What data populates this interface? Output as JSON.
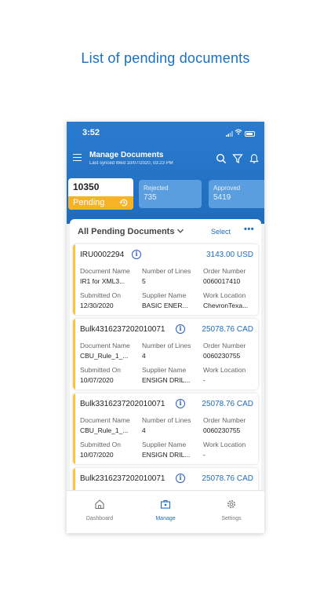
{
  "caption": "List of pending documents",
  "status_bar": {
    "time": "3:52"
  },
  "header": {
    "title": "Manage Documents",
    "subtitle": "Last synced Wed 10/07/2020, 03:23 PM"
  },
  "tiles": {
    "pending": {
      "count": "10350",
      "label": "Pending"
    },
    "rejected": {
      "label": "Rejected",
      "value": "735"
    },
    "approved": {
      "label": "Approved",
      "value": "5419"
    }
  },
  "list": {
    "title": "All Pending Documents",
    "select_label": "Select",
    "more_label": "•••",
    "labels": {
      "document_name": "Document Name",
      "number_of_lines": "Number of Lines",
      "order_number": "Order Number",
      "submitted_on": "Submitted On",
      "supplier_name": "Supplier Name",
      "work_location": "Work Location"
    },
    "cards": [
      {
        "id": "IRU0002294",
        "amount": "3143.00 USD",
        "document_name": "IR1 for XML3...",
        "number_of_lines": "5",
        "order_number": "0060017410",
        "submitted_on": "12/30/2020",
        "supplier_name": "BASIC ENER...",
        "work_location": "ChevronTexa..."
      },
      {
        "id": "Bulk4316237202010071",
        "amount": "25078.76 CAD",
        "document_name": "CBU_Rule_1_...",
        "number_of_lines": "4",
        "order_number": "0060230755",
        "submitted_on": "10/07/2020",
        "supplier_name": "ENSIGN DRIL...",
        "work_location": "-"
      },
      {
        "id": "Bulk3316237202010071",
        "amount": "25078.76 CAD",
        "document_name": "CBU_Rule_1_...",
        "number_of_lines": "4",
        "order_number": "0060230755",
        "submitted_on": "10/07/2020",
        "supplier_name": "ENSIGN DRIL...",
        "work_location": "-"
      },
      {
        "id": "Bulk2316237202010071",
        "amount": "25078.76 CAD"
      }
    ]
  },
  "tabbar": {
    "items": [
      {
        "label": "Dashboard",
        "icon": "home-icon"
      },
      {
        "label": "Manage",
        "icon": "briefcase-icon",
        "active": true
      },
      {
        "label": "Settings",
        "icon": "gear-icon"
      }
    ]
  },
  "colors": {
    "primary": "#1f6cbd",
    "pending_accent": "#f7b328",
    "tile_inactive": "#5b9ee0"
  }
}
